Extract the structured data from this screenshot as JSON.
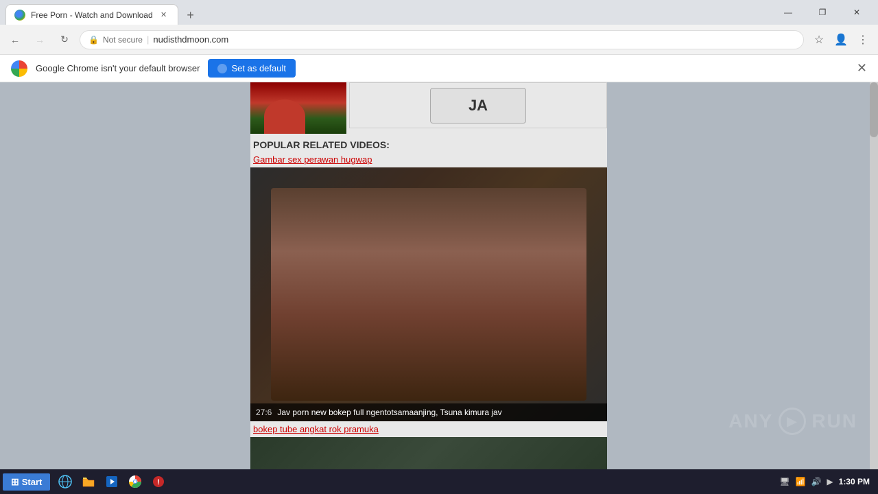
{
  "browser": {
    "tab": {
      "title": "Free Porn - Watch and Download",
      "favicon": "globe-icon"
    },
    "new_tab_label": "+",
    "window_controls": {
      "minimize": "—",
      "maximize": "❐",
      "close": "✕"
    },
    "address_bar": {
      "back_disabled": false,
      "forward_disabled": true,
      "security_label": "Not secure",
      "url": "nudisthdmoon.com",
      "divider": "|"
    }
  },
  "notification": {
    "message": "Google Chrome isn't your default browser",
    "button_label": "Set as default",
    "close_label": "✕"
  },
  "page": {
    "ja_button_label": "JA",
    "related_title": "POPULAR RELATED VIDEOS:",
    "video1_link": "Gambar sex perawan hugwap",
    "video1_duration": "27:6",
    "video1_caption": "Jav porn new bokep full ngentotsamaanjing, Tsuna kimura jav",
    "video2_link": "bokep tube angkat rok pramuka"
  },
  "anyrun": {
    "label": "ANY",
    "run_label": "RUN"
  },
  "taskbar": {
    "start_label": "Start",
    "time": "1:30 PM"
  }
}
